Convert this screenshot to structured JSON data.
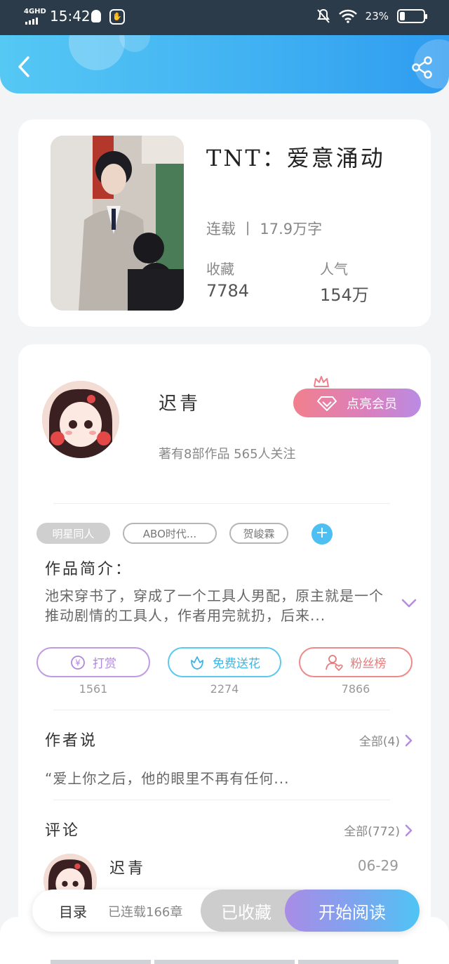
{
  "status_bar": {
    "network": "4GHD",
    "time": "15:42",
    "battery": "23%",
    "battery_level": 0.23
  },
  "header": {
    "back_icon": "chevron-left-icon",
    "share_icon": "share-icon"
  },
  "book": {
    "title": "TNT：爱意涌动",
    "status": "连载 丨 17.9万字",
    "favorites_label": "收藏",
    "favorites_value": "7784",
    "popularity_label": "人气",
    "popularity_value": "154万"
  },
  "author": {
    "name": "迟青",
    "meta": "著有8部作品 565人关注",
    "vip_label": "点亮会员"
  },
  "tags": [
    "明星同人",
    "ABO时代...",
    "贺峻霖"
  ],
  "intro": {
    "title": "作品简介：",
    "text": "池宋穿书了，穿成了一个工具人男配，原主就是一个推动剧情的工具人，作者用完就扔，后来..."
  },
  "actions": [
    {
      "label": "打赏",
      "count": "1561",
      "icon": "yen-icon"
    },
    {
      "label": "免费送花",
      "count": "2274",
      "icon": "flower-icon"
    },
    {
      "label": "粉丝榜",
      "count": "7866",
      "icon": "fans-icon"
    }
  ],
  "author_say": {
    "title": "作者说",
    "more": "全部(4)",
    "text": "“爱上你之后，他的眼里不再有任何..."
  },
  "comments": {
    "title": "评论",
    "more": "全部(772)",
    "first": {
      "name": "迟青",
      "date": "06-29"
    }
  },
  "bottom": {
    "toc": "目录",
    "chapters": "已连载166章",
    "collected": "已收藏",
    "read": "开始阅读"
  },
  "colors": {
    "header": "#3fb0f2",
    "accent_blue": "#4ebff2",
    "vip_pink": "#f2808d",
    "reward_purple": "#b088de",
    "fans_red": "#e57c7c"
  }
}
